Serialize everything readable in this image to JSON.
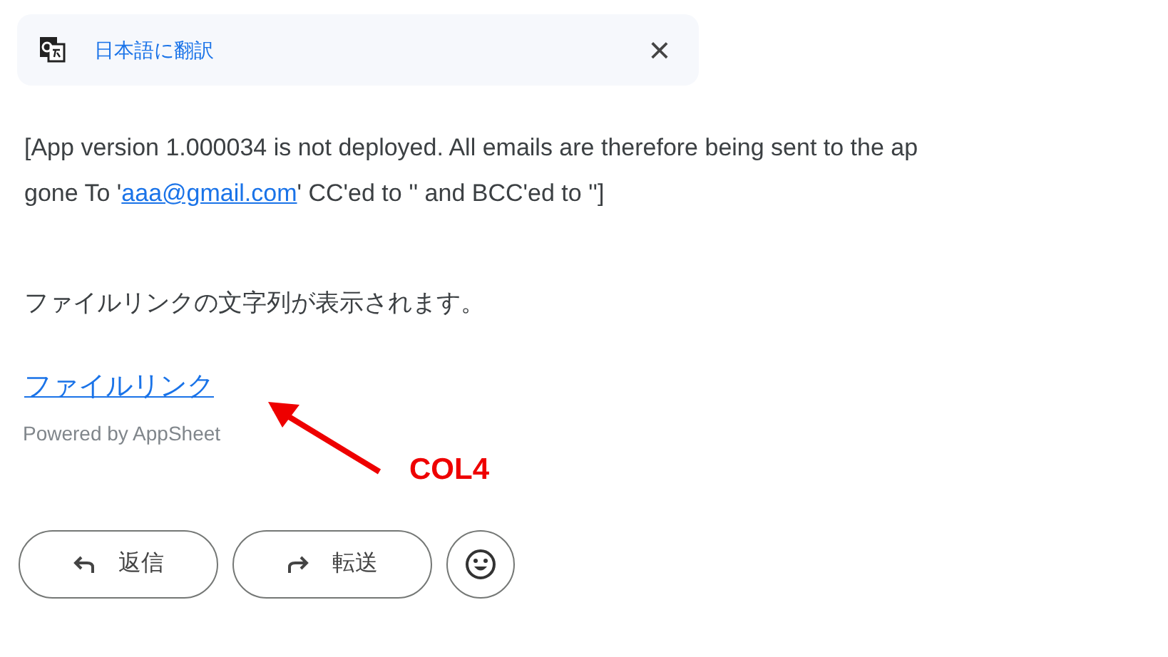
{
  "translate_bar": {
    "label": "日本語に翻訳",
    "close": "×"
  },
  "message": {
    "lines": [
      "[App version 1.000034 is not deployed. All emails are therefore being sent to the ap",
      "gone To '",
      "aaa@gmail.com",
      "' CC'ed to '' and BCC'ed to '']"
    ],
    "body": "ファイルリンクの文字列が表示されます。",
    "file_link": "ファイルリンク",
    "powered_by": "Powered by AppSheet"
  },
  "annotation": {
    "label": "COL4"
  },
  "buttons": [
    {
      "kind": "reply",
      "label": "返信"
    },
    {
      "kind": "forward",
      "label": "転送"
    },
    {
      "kind": "emoji"
    }
  ]
}
